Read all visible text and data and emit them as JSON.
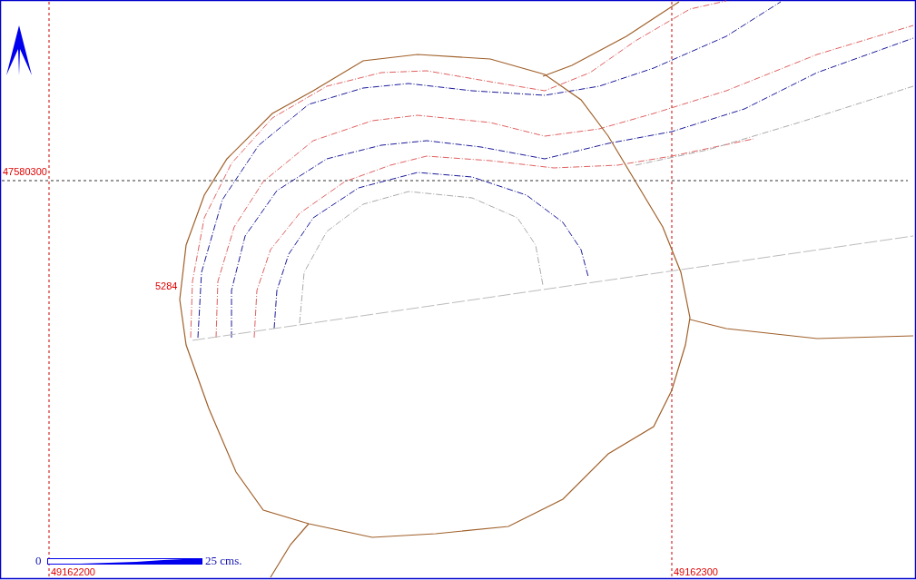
{
  "map": {
    "northing_label": "47580300",
    "easting_labels": [
      "49162200",
      "49162300"
    ],
    "point_label": "5284"
  },
  "scale_bar": {
    "start_label": "0",
    "end_label": "25 cms."
  }
}
